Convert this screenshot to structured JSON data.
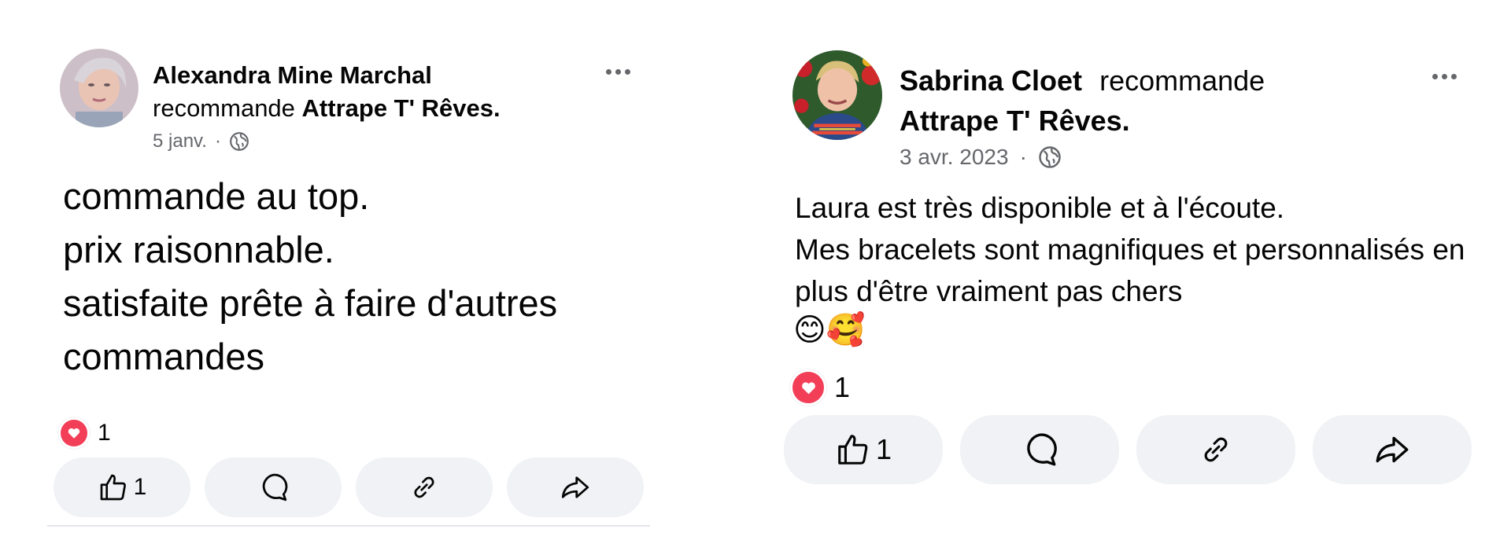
{
  "posts": [
    {
      "author": "Alexandra Mine Marchal",
      "verb": "recommande",
      "page": "Attrape T' Rêves.",
      "date": "5 janv.",
      "separator": "·",
      "text": "commande au top.\nprix raisonnable.\nsatisfaite prête à faire d'autres commandes",
      "reaction_count": "1",
      "like_count": "1",
      "icons": [
        "more-icon",
        "globe-icon",
        "love-reaction-icon",
        "like-icon",
        "comment-icon",
        "link-icon",
        "share-icon"
      ]
    },
    {
      "author": "Sabrina Cloet",
      "verb": "recommande",
      "page": "Attrape T' Rêves.",
      "date": "3 avr. 2023",
      "separator": "·",
      "text": "Laura est très disponible et à l'écoute.\nMes bracelets sont magnifiques et personnalisés en plus d'être vraiment pas chers",
      "emojis": "😊🥰",
      "reaction_count": "1",
      "like_count": "1",
      "icons": [
        "more-icon",
        "globe-icon",
        "love-reaction-icon",
        "like-icon",
        "comment-icon",
        "link-icon",
        "share-icon"
      ]
    }
  ],
  "colors": {
    "button_bg": "#f0f2f5",
    "muted_text": "#65676b",
    "love_red": "#f33e58"
  }
}
